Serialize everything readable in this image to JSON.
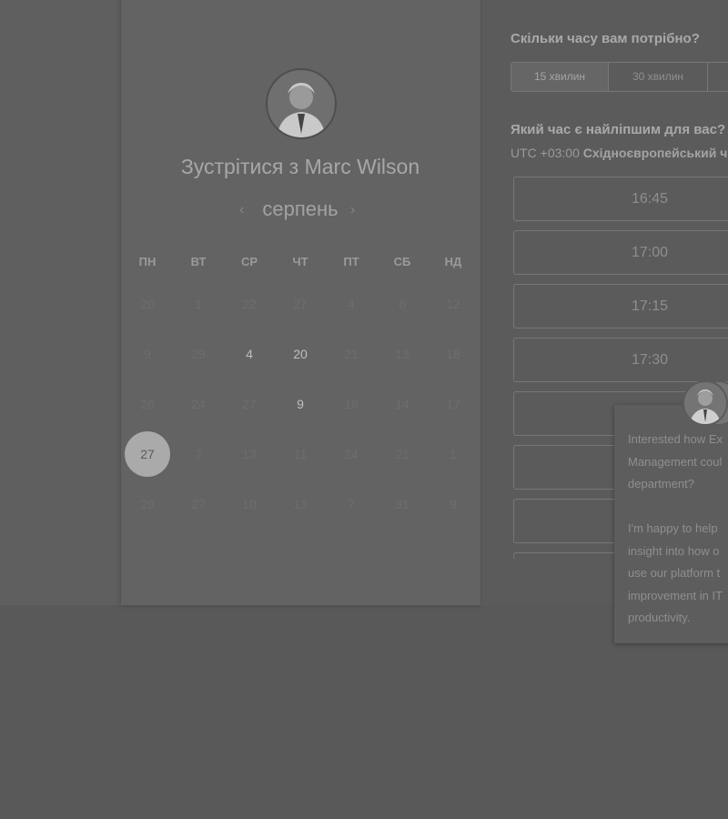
{
  "meet_title": "Зустрітися з Marc Wilson",
  "calendar": {
    "month": "серпень",
    "prev_icon": "‹",
    "next_icon": "›",
    "weekdays": [
      "ПН",
      "ВТ",
      "СР",
      "ЧТ",
      "ПТ",
      "СБ",
      "НД"
    ],
    "weeks": [
      [
        "20",
        "1",
        "22",
        "27",
        "4",
        "6",
        "12"
      ],
      [
        "9",
        "29",
        "4",
        "20",
        "21",
        "13",
        "18"
      ],
      [
        "26",
        "24",
        "27",
        "9",
        "19",
        "14",
        "17"
      ],
      [
        "27",
        "7",
        "13",
        "11",
        "24",
        "21",
        "1"
      ],
      [
        "29",
        "27",
        "10",
        "13",
        "7",
        "31",
        "9"
      ]
    ],
    "available": [
      "1.2",
      "1.3",
      "2.3"
    ],
    "selected": "3.0"
  },
  "duration": {
    "question": "Скільки часу вам потрібно?",
    "options": [
      "15 хвилин",
      "30 хвилин"
    ],
    "active_index": 0
  },
  "time": {
    "question": "Який час є найліпшим для вас?",
    "timezone_offset": "UTC +03:00",
    "timezone_name": "Східноєвропейський ч",
    "slots": [
      "16:45",
      "17:00",
      "17:15",
      "17:30",
      "",
      "",
      ""
    ]
  },
  "chat": {
    "lines": [
      "Interested how Ex",
      "Management coul",
      "department?",
      "",
      "I'm happy to help",
      "insight into how o",
      "use our platform t",
      "improvement in IT",
      "productivity."
    ]
  }
}
